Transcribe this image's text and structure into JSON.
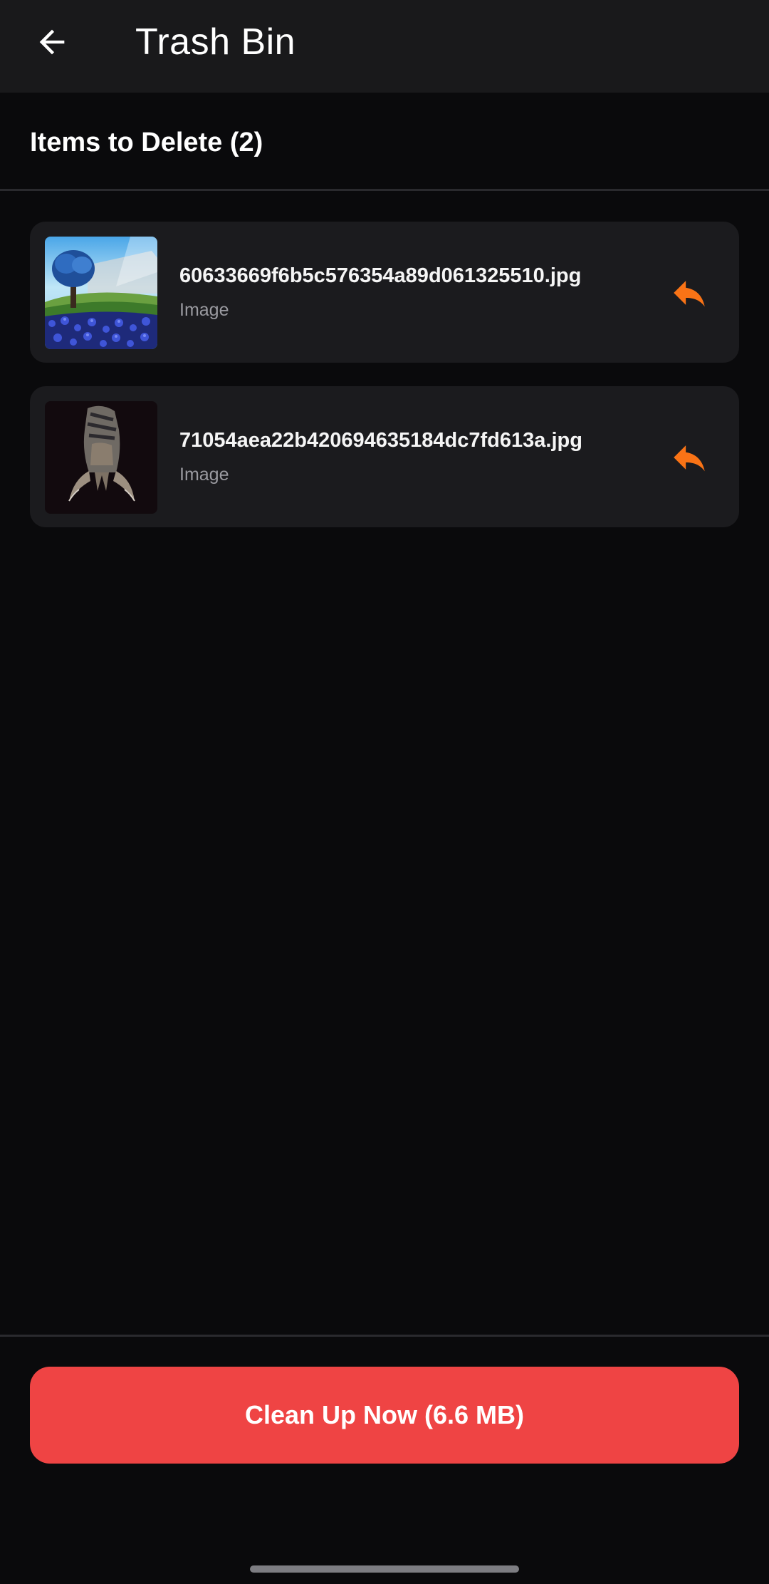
{
  "appbar": {
    "title": "Trash Bin",
    "back_icon": "arrow-left-icon"
  },
  "section": {
    "header": "Items to Delete (2)"
  },
  "items": [
    {
      "name": "60633669f6b5c576354a89d061325510.jpg",
      "type": "Image",
      "thumbnail": "landscape-tree-blue-flowers",
      "restore_icon": "reply-arrow-icon"
    },
    {
      "name": "71054aea22b420694635184dc7fd613a.jpg",
      "type": "Image",
      "thumbnail": "dark-claw-figure",
      "restore_icon": "reply-arrow-icon"
    }
  ],
  "footer": {
    "cleanup_label": "Clean Up Now (6.6 MB)"
  },
  "colors": {
    "background": "#0a0a0c",
    "appbar": "#19191b",
    "card": "#1b1b1e",
    "accent_restore": "#f97316",
    "danger": "#ef4444",
    "secondary_text": "#9a9aa0"
  }
}
